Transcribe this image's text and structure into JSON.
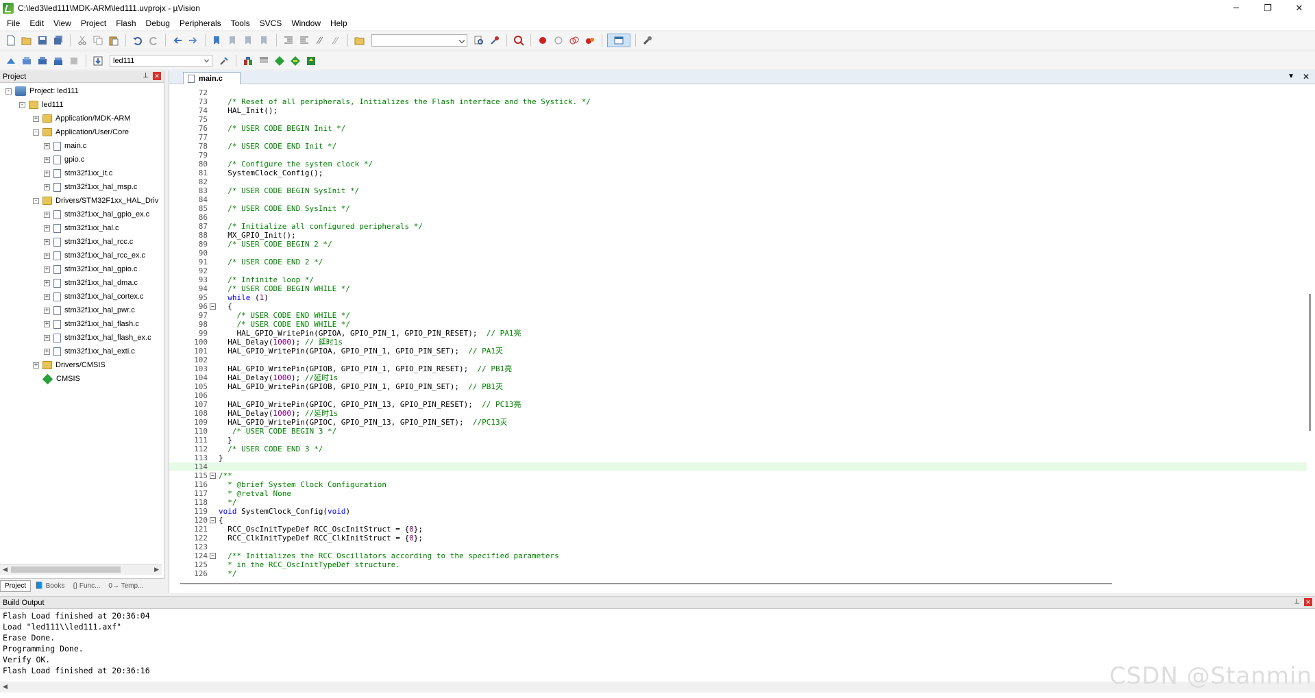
{
  "window": {
    "title": "C:\\led3\\led111\\MDK-ARM\\led111.uvprojx - µVision",
    "minimize": "─",
    "maximize": "❐",
    "close": "✕"
  },
  "menu": [
    "File",
    "Edit",
    "View",
    "Project",
    "Flash",
    "Debug",
    "Peripherals",
    "Tools",
    "SVCS",
    "Window",
    "Help"
  ],
  "toolbar2": {
    "target": "led111"
  },
  "project_panel": {
    "title": "Project",
    "tree": [
      {
        "label": "Project: led111",
        "level": 0,
        "type": "project",
        "exp": "-"
      },
      {
        "label": "led111",
        "level": 1,
        "type": "folder",
        "exp": "-"
      },
      {
        "label": "Application/MDK-ARM",
        "level": 2,
        "type": "folder",
        "exp": "+"
      },
      {
        "label": "Application/User/Core",
        "level": 2,
        "type": "folder",
        "exp": "-"
      },
      {
        "label": "main.c",
        "level": 3,
        "type": "file",
        "exp": "+"
      },
      {
        "label": "gpio.c",
        "level": 3,
        "type": "file",
        "exp": "+"
      },
      {
        "label": "stm32f1xx_it.c",
        "level": 3,
        "type": "file",
        "exp": "+"
      },
      {
        "label": "stm32f1xx_hal_msp.c",
        "level": 3,
        "type": "file",
        "exp": "+"
      },
      {
        "label": "Drivers/STM32F1xx_HAL_Driv",
        "level": 2,
        "type": "folder",
        "exp": "-"
      },
      {
        "label": "stm32f1xx_hal_gpio_ex.c",
        "level": 3,
        "type": "file",
        "exp": "+"
      },
      {
        "label": "stm32f1xx_hal.c",
        "level": 3,
        "type": "file",
        "exp": "+"
      },
      {
        "label": "stm32f1xx_hal_rcc.c",
        "level": 3,
        "type": "file",
        "exp": "+"
      },
      {
        "label": "stm32f1xx_hal_rcc_ex.c",
        "level": 3,
        "type": "file",
        "exp": "+"
      },
      {
        "label": "stm32f1xx_hal_gpio.c",
        "level": 3,
        "type": "file",
        "exp": "+"
      },
      {
        "label": "stm32f1xx_hal_dma.c",
        "level": 3,
        "type": "file",
        "exp": "+"
      },
      {
        "label": "stm32f1xx_hal_cortex.c",
        "level": 3,
        "type": "file",
        "exp": "+"
      },
      {
        "label": "stm32f1xx_hal_pwr.c",
        "level": 3,
        "type": "file",
        "exp": "+"
      },
      {
        "label": "stm32f1xx_hal_flash.c",
        "level": 3,
        "type": "file",
        "exp": "+"
      },
      {
        "label": "stm32f1xx_hal_flash_ex.c",
        "level": 3,
        "type": "file",
        "exp": "+"
      },
      {
        "label": "stm32f1xx_hal_exti.c",
        "level": 3,
        "type": "file",
        "exp": "+"
      },
      {
        "label": "Drivers/CMSIS",
        "level": 2,
        "type": "folder",
        "exp": "+"
      },
      {
        "label": "CMSIS",
        "level": 2,
        "type": "cmsis",
        "exp": ""
      }
    ],
    "tabs": [
      "Project",
      "Books",
      "{} Func...",
      "0→ Temp..."
    ]
  },
  "editor": {
    "tab": "main.c",
    "current_line": 114,
    "lines": [
      {
        "n": 72,
        "t": ""
      },
      {
        "n": 73,
        "t": "  /* Reset of all peripherals, Initializes the Flash interface and the Systick. */",
        "cls": "c-cmt"
      },
      {
        "n": 74,
        "t": "  HAL_Init();"
      },
      {
        "n": 75,
        "t": ""
      },
      {
        "n": 76,
        "t": "  /* USER CODE BEGIN Init */",
        "cls": "c-cmt"
      },
      {
        "n": 77,
        "t": ""
      },
      {
        "n": 78,
        "t": "  /* USER CODE END Init */",
        "cls": "c-cmt"
      },
      {
        "n": 79,
        "t": ""
      },
      {
        "n": 80,
        "t": "  /* Configure the system clock */",
        "cls": "c-cmt"
      },
      {
        "n": 81,
        "t": "  SystemClock_Config();"
      },
      {
        "n": 82,
        "t": ""
      },
      {
        "n": 83,
        "t": "  /* USER CODE BEGIN SysInit */",
        "cls": "c-cmt"
      },
      {
        "n": 84,
        "t": ""
      },
      {
        "n": 85,
        "t": "  /* USER CODE END SysInit */",
        "cls": "c-cmt"
      },
      {
        "n": 86,
        "t": ""
      },
      {
        "n": 87,
        "t": "  /* Initialize all configured peripherals */",
        "cls": "c-cmt"
      },
      {
        "n": 88,
        "t": "  MX_GPIO_Init();"
      },
      {
        "n": 89,
        "t": "  /* USER CODE BEGIN 2 */",
        "cls": "c-cmt"
      },
      {
        "n": 90,
        "t": ""
      },
      {
        "n": 91,
        "t": "  /* USER CODE END 2 */",
        "cls": "c-cmt"
      },
      {
        "n": 92,
        "t": ""
      },
      {
        "n": 93,
        "t": "  /* Infinite loop */",
        "cls": "c-cmt"
      },
      {
        "n": 94,
        "t": "  /* USER CODE BEGIN WHILE */",
        "cls": "c-cmt"
      },
      {
        "n": 95,
        "parts": [
          [
            "  ",
            ""
          ],
          [
            "while",
            "c-kw"
          ],
          [
            " (",
            ""
          ],
          [
            "1",
            "c-num"
          ],
          [
            ")",
            ""
          ]
        ]
      },
      {
        "n": 96,
        "t": "  {",
        "fold": "-"
      },
      {
        "n": 97,
        "t": "    /* USER CODE END WHILE */",
        "cls": "c-cmt"
      },
      {
        "n": 98,
        "t": "    /* USER CODE END WHILE */",
        "cls": "c-cmt"
      },
      {
        "n": 99,
        "parts": [
          [
            "    HAL_GPIO_WritePin(GPIOA, GPIO_PIN_1, GPIO_PIN_RESET);  ",
            ""
          ],
          [
            "// PA1亮",
            "c-cmt"
          ]
        ]
      },
      {
        "n": 100,
        "parts": [
          [
            "  HAL_Delay(",
            ""
          ],
          [
            "1000",
            "c-num"
          ],
          [
            "); ",
            ""
          ],
          [
            "// 延时1s",
            "c-cmt"
          ]
        ]
      },
      {
        "n": 101,
        "parts": [
          [
            "  HAL_GPIO_WritePin(GPIOA, GPIO_PIN_1, GPIO_PIN_SET);  ",
            ""
          ],
          [
            "// PA1灭",
            "c-cmt"
          ]
        ]
      },
      {
        "n": 102,
        "t": ""
      },
      {
        "n": 103,
        "parts": [
          [
            "  HAL_GPIO_WritePin(GPIOB, GPIO_PIN_1, GPIO_PIN_RESET);  ",
            ""
          ],
          [
            "// PB1亮",
            "c-cmt"
          ]
        ]
      },
      {
        "n": 104,
        "parts": [
          [
            "  HAL_Delay(",
            ""
          ],
          [
            "1000",
            "c-num"
          ],
          [
            "); ",
            ""
          ],
          [
            "//延时1s",
            "c-cmt"
          ]
        ]
      },
      {
        "n": 105,
        "parts": [
          [
            "  HAL_GPIO_WritePin(GPIOB, GPIO_PIN_1, GPIO_PIN_SET);  ",
            ""
          ],
          [
            "// PB1灭",
            "c-cmt"
          ]
        ]
      },
      {
        "n": 106,
        "t": ""
      },
      {
        "n": 107,
        "parts": [
          [
            "  HAL_GPIO_WritePin(GPIOC, GPIO_PIN_13, GPIO_PIN_RESET);  ",
            ""
          ],
          [
            "// PC13亮",
            "c-cmt"
          ]
        ]
      },
      {
        "n": 108,
        "parts": [
          [
            "  HAL_Delay(",
            ""
          ],
          [
            "1000",
            "c-num"
          ],
          [
            "); ",
            ""
          ],
          [
            "//延时1s",
            "c-cmt"
          ]
        ]
      },
      {
        "n": 109,
        "parts": [
          [
            "  HAL_GPIO_WritePin(GPIOC, GPIO_PIN_13, GPIO_PIN_SET);  ",
            ""
          ],
          [
            "//PC13灭",
            "c-cmt"
          ]
        ]
      },
      {
        "n": 110,
        "t": "   /* USER CODE BEGIN 3 */",
        "cls": "c-cmt"
      },
      {
        "n": 111,
        "t": "  }"
      },
      {
        "n": 112,
        "t": "  /* USER CODE END 3 */",
        "cls": "c-cmt"
      },
      {
        "n": 113,
        "t": "}"
      },
      {
        "n": 114,
        "t": "",
        "cur": true
      },
      {
        "n": 115,
        "t": "/**",
        "cls": "c-cmt",
        "fold": "-"
      },
      {
        "n": 116,
        "t": "  * @brief System Clock Configuration",
        "cls": "c-cmt"
      },
      {
        "n": 117,
        "t": "  * @retval None",
        "cls": "c-cmt"
      },
      {
        "n": 118,
        "t": "  */",
        "cls": "c-cmt"
      },
      {
        "n": 119,
        "parts": [
          [
            "void",
            "c-kw"
          ],
          [
            " SystemClock_Config(",
            ""
          ],
          [
            "void",
            "c-kw"
          ],
          [
            ")",
            ""
          ]
        ]
      },
      {
        "n": 120,
        "t": "{",
        "fold": "-"
      },
      {
        "n": 121,
        "parts": [
          [
            "  RCC_OscInitTypeDef RCC_OscInitStruct = {",
            ""
          ],
          [
            "0",
            "c-num"
          ],
          [
            "};",
            ""
          ]
        ]
      },
      {
        "n": 122,
        "parts": [
          [
            "  RCC_ClkInitTypeDef RCC_ClkInitStruct = {",
            ""
          ],
          [
            "0",
            "c-num"
          ],
          [
            "};",
            ""
          ]
        ]
      },
      {
        "n": 123,
        "t": ""
      },
      {
        "n": 124,
        "t": "  /** Initializes the RCC Oscillators according to the specified parameters",
        "cls": "c-cmt",
        "fold": "-"
      },
      {
        "n": 125,
        "t": "  * in the RCC_OscInitTypeDef structure.",
        "cls": "c-cmt"
      },
      {
        "n": 126,
        "t": "  */",
        "cls": "c-cmt"
      }
    ]
  },
  "build_output": {
    "title": "Build Output",
    "lines": [
      "Flash Load finished at 20:36:04",
      "Load \"led111\\\\led111.axf\"",
      "Erase Done.",
      "Programming Done.",
      "Verify OK.",
      "Flash Load finished at 20:36:16"
    ]
  },
  "watermark": "CSDN @Stanmin",
  "colors": {
    "comment": "#008000",
    "keyword": "#0000ff",
    "number": "#800080",
    "current_line": "#e8fbe8"
  }
}
